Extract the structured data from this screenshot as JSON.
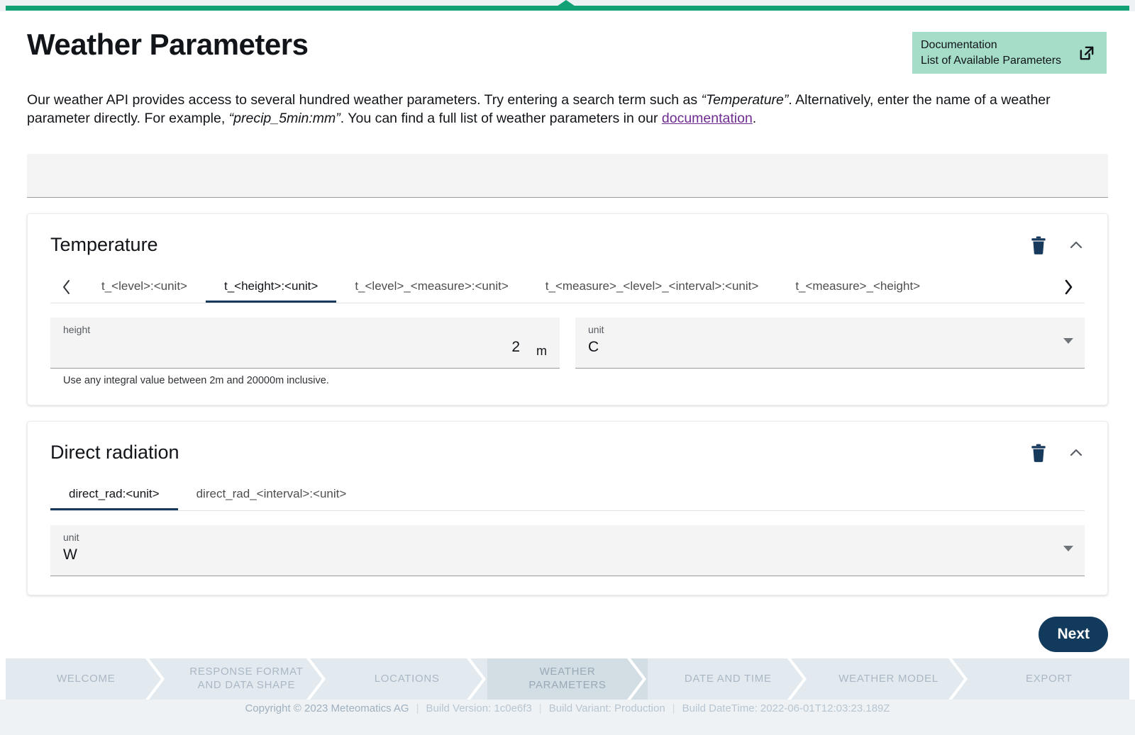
{
  "brand": {
    "accent_green": "#12a077",
    "navy": "#123a5c",
    "mint": "#a5ddc9",
    "link_purple": "#6e2b91"
  },
  "header": {
    "title": "Weather Parameters",
    "doc_box": {
      "line1": "Documentation",
      "line2": "List of Available Parameters",
      "icon": "external-link-icon"
    }
  },
  "intro": {
    "part1": "Our weather API provides access to several hundred weather parameters. Try entering a search term such as ",
    "quote1": "“Temperature”",
    "part2": ". Alternatively, enter the name of a weather parameter directly. For example, ",
    "quote2": "“precip_5min:mm”",
    "part3": ". You can find a full list of weather parameters in our ",
    "link": "documentation",
    "part4": "."
  },
  "search": {
    "value": "",
    "placeholder": ""
  },
  "cards": [
    {
      "title": "Temperature",
      "delete_icon": "trash-icon",
      "collapse_icon": "chevron-up-icon",
      "scroll_left_icon": "chevron-left-icon",
      "scroll_right_icon": "chevron-right-icon",
      "has_scroll_arrows": true,
      "tabs": [
        {
          "label": "t_<level>:<unit>",
          "active": false
        },
        {
          "label": "t_<height>:<unit>",
          "active": true
        },
        {
          "label": "t_<level>_<measure>:<unit>",
          "active": false
        },
        {
          "label": "t_<measure>_<level>_<interval>:<unit>",
          "active": false
        },
        {
          "label": "t_<measure>_<height>",
          "active": false
        }
      ],
      "fields": [
        {
          "kind": "number",
          "label": "height",
          "value": "2",
          "suffix": "m",
          "help": "Use any integral value between 2m and 20000m inclusive."
        },
        {
          "kind": "select",
          "label": "unit",
          "value": "C",
          "caret_icon": "caret-down-icon"
        }
      ]
    },
    {
      "title": "Direct radiation",
      "delete_icon": "trash-icon",
      "collapse_icon": "chevron-up-icon",
      "has_scroll_arrows": false,
      "tabs": [
        {
          "label": "direct_rad:<unit>",
          "active": true
        },
        {
          "label": "direct_rad_<interval>:<unit>",
          "active": false
        }
      ],
      "fields": [
        {
          "kind": "select",
          "label": "unit",
          "value": "W",
          "caret_icon": "caret-down-icon"
        }
      ]
    }
  ],
  "actions": {
    "next_label": "Next"
  },
  "stepper": {
    "steps": [
      {
        "label": "WELCOME",
        "active": false
      },
      {
        "label": "RESPONSE FORMAT AND DATA SHAPE",
        "active": false
      },
      {
        "label": "LOCATIONS",
        "active": false
      },
      {
        "label": "WEATHER PARAMETERS",
        "active": true
      },
      {
        "label": "DATE AND TIME",
        "active": false
      },
      {
        "label": "WEATHER MODEL",
        "active": false
      },
      {
        "label": "EXPORT",
        "active": false
      }
    ]
  },
  "footer": {
    "copyright": "Copyright © 2023 Meteomatics AG",
    "build_version": "Build Version: 1c0e6f3",
    "build_variant": "Build Variant: Production",
    "build_datetime": "Build DateTime: 2022-06-01T12:03:23.189Z"
  }
}
